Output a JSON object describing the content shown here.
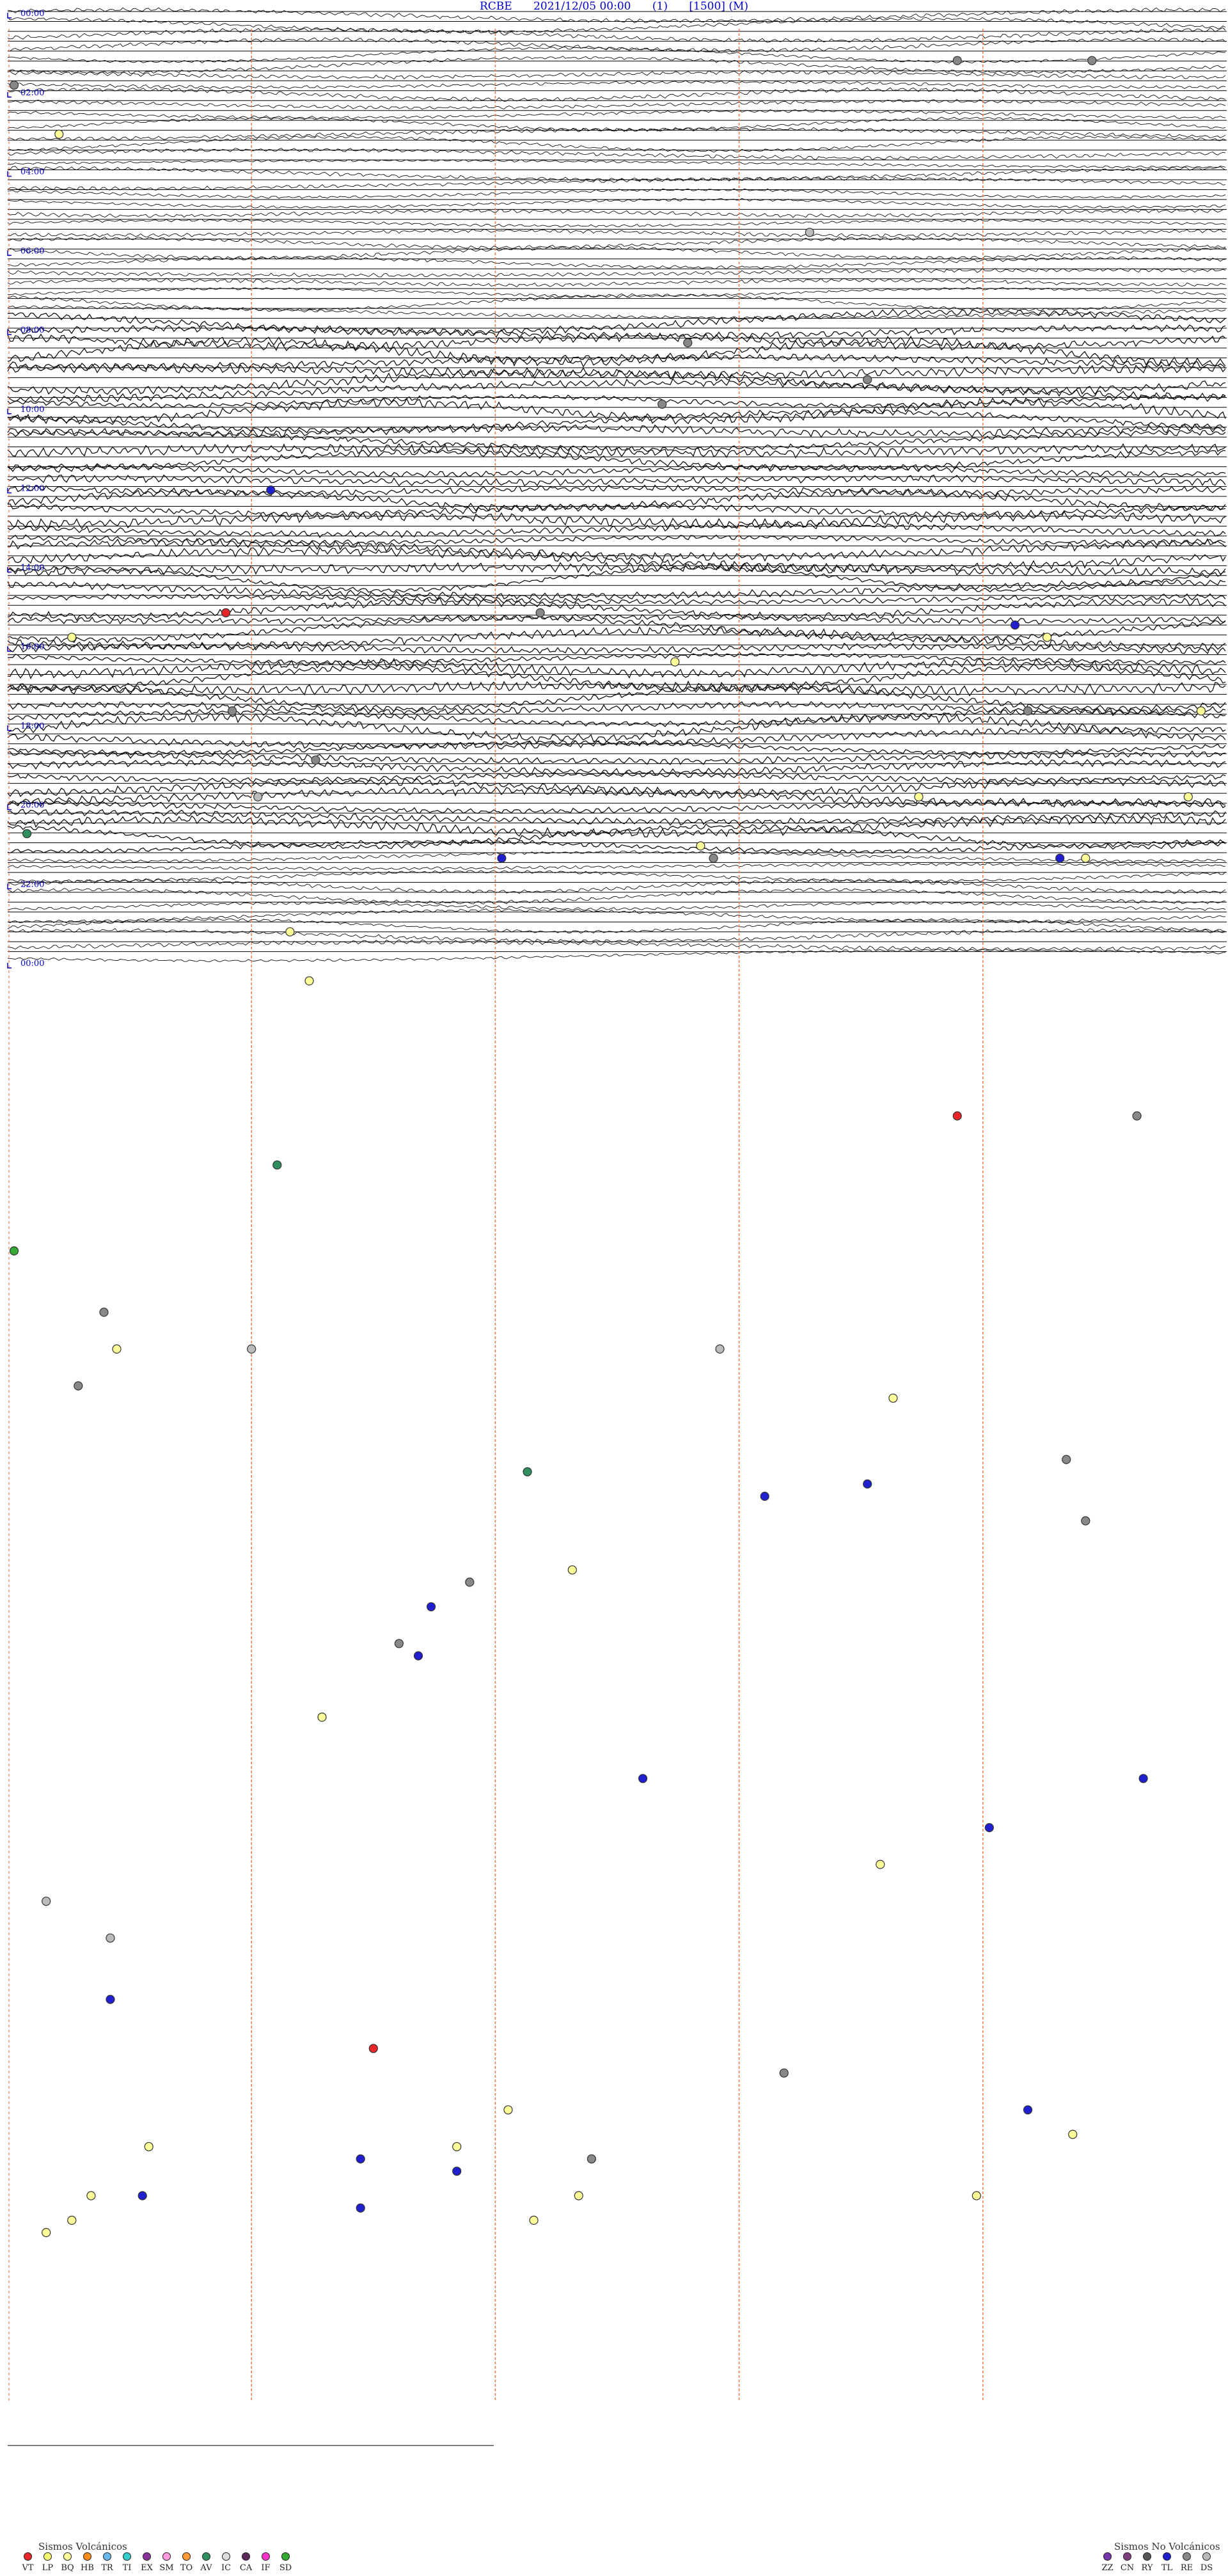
{
  "header": {
    "station": "RCBE",
    "datetime": "2021/12/05 00:00",
    "channel": "(1)",
    "scale": "[1500] (M)"
  },
  "chart_data": {
    "type": "scatter",
    "hour_labels": [
      "00:00",
      "02:00",
      "04:00",
      "06:00",
      "08:00",
      "10:00",
      "12:00",
      "14:00",
      "16:00",
      "18:00",
      "20:00",
      "22:00",
      "00:00"
    ],
    "ylim_minutes": [
      0,
      1440
    ],
    "xlim_minutes": [
      0,
      15
    ],
    "trace_interval_minutes": 15,
    "event_colors": {
      "VT": "#e8262a",
      "LP": "#f5f56e",
      "BQ": "#ffff99",
      "HB": "#ff8c1a",
      "TR": "#6ab8f0",
      "TI": "#33cccc",
      "EX": "#883399",
      "SM": "#ff99dd",
      "TO": "#ff9933",
      "AV": "#2f8f5f",
      "IC": "#dddddd",
      "CA": "#5b2a5b",
      "IF": "#ff33cc",
      "SD": "#33aa33",
      "ZZ": "#7733aa",
      "CN": "#7f3f7f",
      "RY": "#555555",
      "TL": "#1f1fd0",
      "RE": "#888888",
      "DS": "#bbbbbb"
    },
    "events": [
      {
        "t": 4,
        "x": 14.8,
        "type": "RE"
      },
      {
        "t": 4,
        "x": 16.9,
        "type": "RE"
      },
      {
        "t": 6,
        "x": 0.1,
        "type": "RE"
      },
      {
        "t": 10,
        "x": 0.8,
        "type": "BQ"
      },
      {
        "t": 18,
        "x": 12.5,
        "type": "DS"
      },
      {
        "t": 27,
        "x": 10.6,
        "type": "RE"
      },
      {
        "t": 30,
        "x": 13.4,
        "type": "RE"
      },
      {
        "t": 32,
        "x": 10.2,
        "type": "RE"
      },
      {
        "t": 39,
        "x": 4.1,
        "type": "TL"
      },
      {
        "t": 49,
        "x": 3.4,
        "type": "VT"
      },
      {
        "t": 49,
        "x": 8.3,
        "type": "RE"
      },
      {
        "t": 50,
        "x": 15.7,
        "type": "TL"
      },
      {
        "t": 51,
        "x": 1.0,
        "type": "BQ"
      },
      {
        "t": 51,
        "x": 16.2,
        "type": "BQ"
      },
      {
        "t": 53,
        "x": 10.4,
        "type": "BQ"
      },
      {
        "t": 57,
        "x": 3.5,
        "type": "RE"
      },
      {
        "t": 57,
        "x": 15.9,
        "type": "RE"
      },
      {
        "t": 57,
        "x": 18.6,
        "type": "BQ"
      },
      {
        "t": 61,
        "x": 4.8,
        "type": "RE"
      },
      {
        "t": 64,
        "x": 3.9,
        "type": "DS"
      },
      {
        "t": 64,
        "x": 14.2,
        "type": "BQ"
      },
      {
        "t": 64,
        "x": 18.4,
        "type": "BQ"
      },
      {
        "t": 67,
        "x": 0.3,
        "type": "AV"
      },
      {
        "t": 68,
        "x": 10.8,
        "type": "BQ"
      },
      {
        "t": 69,
        "x": 7.7,
        "type": "TL"
      },
      {
        "t": 69,
        "x": 16.4,
        "type": "TL"
      },
      {
        "t": 69,
        "x": 11.0,
        "type": "RE"
      },
      {
        "t": 69,
        "x": 16.8,
        "type": "BQ"
      },
      {
        "t": 75,
        "x": 4.4,
        "type": "BQ"
      },
      {
        "t": 79,
        "x": 4.7,
        "type": "BQ"
      },
      {
        "t": 90,
        "x": 14.8,
        "type": "VT"
      },
      {
        "t": 90,
        "x": 17.6,
        "type": "RE"
      },
      {
        "t": 94,
        "x": 4.2,
        "type": "AV"
      },
      {
        "t": 101,
        "x": 0.1,
        "type": "SD"
      },
      {
        "t": 106,
        "x": 1.5,
        "type": "RE"
      },
      {
        "t": 109,
        "x": 1.7,
        "type": "BQ"
      },
      {
        "t": 109,
        "x": 3.8,
        "type": "DS"
      },
      {
        "t": 109,
        "x": 11.1,
        "type": "DS"
      },
      {
        "t": 112,
        "x": 1.1,
        "type": "RE"
      },
      {
        "t": 113,
        "x": 13.8,
        "type": "BQ"
      },
      {
        "t": 118,
        "x": 16.5,
        "type": "RE"
      },
      {
        "t": 119,
        "x": 8.1,
        "type": "AV"
      },
      {
        "t": 120,
        "x": 13.4,
        "type": "TL"
      },
      {
        "t": 121,
        "x": 11.8,
        "type": "TL"
      },
      {
        "t": 123,
        "x": 16.8,
        "type": "RE"
      },
      {
        "t": 127,
        "x": 8.8,
        "type": "BQ"
      },
      {
        "t": 128,
        "x": 7.2,
        "type": "RE"
      },
      {
        "t": 130,
        "x": 6.6,
        "type": "TL"
      },
      {
        "t": 133,
        "x": 6.1,
        "type": "RE"
      },
      {
        "t": 134,
        "x": 6.4,
        "type": "TL"
      },
      {
        "t": 139,
        "x": 4.9,
        "type": "BQ"
      },
      {
        "t": 144,
        "x": 9.9,
        "type": "TL"
      },
      {
        "t": 144,
        "x": 17.7,
        "type": "TL"
      },
      {
        "t": 148,
        "x": 15.3,
        "type": "TL"
      },
      {
        "t": 151,
        "x": 13.6,
        "type": "BQ"
      },
      {
        "t": 154,
        "x": 0.6,
        "type": "DS"
      },
      {
        "t": 157,
        "x": 1.6,
        "type": "DS"
      },
      {
        "t": 162,
        "x": 1.6,
        "type": "TL"
      },
      {
        "t": 166,
        "x": 5.7,
        "type": "VT"
      },
      {
        "t": 168,
        "x": 12.1,
        "type": "RE"
      },
      {
        "t": 171,
        "x": 15.9,
        "type": "TL"
      },
      {
        "t": 171,
        "x": 7.8,
        "type": "BQ"
      },
      {
        "t": 173,
        "x": 16.6,
        "type": "BQ"
      },
      {
        "t": 174,
        "x": 7.0,
        "type": "BQ"
      },
      {
        "t": 174,
        "x": 2.2,
        "type": "BQ"
      },
      {
        "t": 175,
        "x": 5.5,
        "type": "TL"
      },
      {
        "t": 175,
        "x": 9.1,
        "type": "RE"
      },
      {
        "t": 176,
        "x": 7.0,
        "type": "TL"
      },
      {
        "t": 178,
        "x": 1.3,
        "type": "BQ"
      },
      {
        "t": 178,
        "x": 2.1,
        "type": "TL"
      },
      {
        "t": 178,
        "x": 8.9,
        "type": "BQ"
      },
      {
        "t": 178,
        "x": 15.1,
        "type": "BQ"
      },
      {
        "t": 179,
        "x": 5.5,
        "type": "TL"
      },
      {
        "t": 180,
        "x": 1.0,
        "type": "BQ"
      },
      {
        "t": 180,
        "x": 8.2,
        "type": "BQ"
      },
      {
        "t": 181,
        "x": 0.6,
        "type": "BQ"
      }
    ]
  },
  "legend": {
    "volcanic_title": "Sismos Volcánicos",
    "volcanic_items": [
      "VT",
      "LP",
      "BQ",
      "HB",
      "TR",
      "TI",
      "EX",
      "SM",
      "TO",
      "AV",
      "IC",
      "CA",
      "IF",
      "SD"
    ],
    "nonvolcanic_title": "Sismos No Volcánicos",
    "nonvolcanic_items": [
      "ZZ",
      "CN",
      "RY",
      "TL",
      "RE",
      "DS"
    ]
  }
}
